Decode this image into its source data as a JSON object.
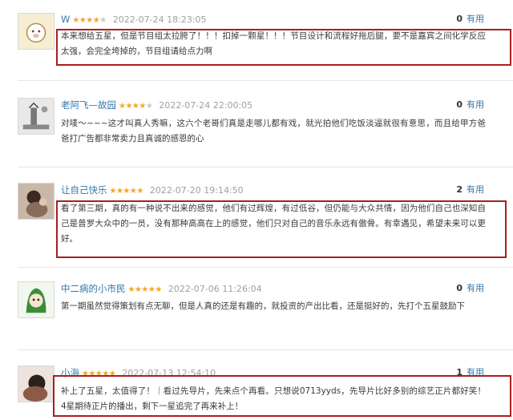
{
  "reviews": [
    {
      "user": "W",
      "stars": 4,
      "time": "2022-07-24 18:23:05",
      "votes": "0",
      "vote_label": "有用",
      "text": "本来想给五星，但是节目组太拉胯了！！！扣掉一颗星！！！节目设计和流程好拖后腿，要不是嘉宾之间化学反应太强，会完全垮掉的，节目组请给点力啊"
    },
    {
      "user": "老阿飞—故园",
      "stars": 4,
      "time": "2022-07-24 22:00:05",
      "votes": "0",
      "vote_label": "有用",
      "text": "对唛～~~~这才叫真人秀嘛，这六个老哥们真是走哪儿都有戏，就光拍他们吃饭淡逼就很有意思，而且给甲方爸爸打广告都非常卖力且真诚的感恩的心"
    },
    {
      "user": "让自己快乐",
      "stars": 5,
      "time": "2022-07-20 19:14:50",
      "votes": "2",
      "vote_label": "有用",
      "text": "看了第三期，真的有一种说不出来的感觉，他们有过辉煌，有过低谷，但仍能与大众共情，因为他们自己也深知自己是普罗大众中的一员，没有那种高高在上的感觉，他们只对自己的音乐永远有傲骨。有幸遇见，希望未来可以更好。"
    },
    {
      "user": "中二病的小市民",
      "stars": 5,
      "time": "2022-07-06 11:26:04",
      "votes": "0",
      "vote_label": "有用",
      "text": "第一期虽然觉得策划有点无聊，但是人真的还是有趣的，就投资的产出比看，还是挺好的，先打个五星鼓励下"
    },
    {
      "user": "小海",
      "stars": 5,
      "time": "2022-07-13 12:54:10",
      "votes": "1",
      "vote_label": "有用",
      "text": "补上了五星，太值得了！｜看过先导片，先来点个再看。只想说0713yyds，先导片比好多别的综艺正片都好笑！4星期待正片的播出，剩下一星追完了再来补上！"
    }
  ],
  "colors": {
    "link": "#3377aa",
    "star": "#f5a623",
    "highlight": "#a81f1f"
  }
}
